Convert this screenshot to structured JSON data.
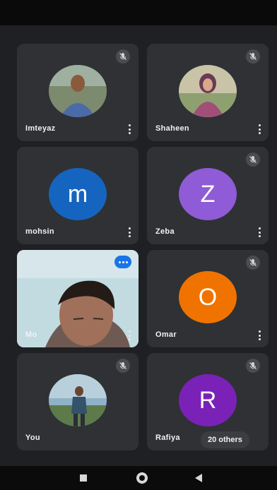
{
  "participants": [
    {
      "name": "Imteyaz",
      "avatar_type": "photo",
      "muted": true
    },
    {
      "name": "Shaheen",
      "avatar_type": "photo",
      "muted": true
    },
    {
      "name": "mohsin",
      "avatar_type": "initial",
      "initial": "m",
      "color": "#1565c0",
      "muted": false
    },
    {
      "name": "Zeba",
      "avatar_type": "initial",
      "initial": "Z",
      "color": "#8f5bd6",
      "muted": true
    },
    {
      "name": "Mo",
      "avatar_type": "video",
      "muted": false
    },
    {
      "name": "Omar",
      "avatar_type": "initial",
      "initial": "O",
      "color": "#f07300",
      "muted": true
    },
    {
      "name": "You",
      "avatar_type": "photo",
      "muted": true
    },
    {
      "name": "Rafiya",
      "avatar_type": "initial",
      "initial": "R",
      "color": "#7a22b8",
      "muted": true
    }
  ],
  "others_chip": {
    "label": "20 others"
  },
  "nav_bar": {
    "icons": [
      "recent-apps-icon",
      "home-icon",
      "back-icon"
    ]
  },
  "colors": {
    "background": "#1f2023",
    "tile": "#2f3134",
    "speaking_indicator": "#1a73e8"
  }
}
